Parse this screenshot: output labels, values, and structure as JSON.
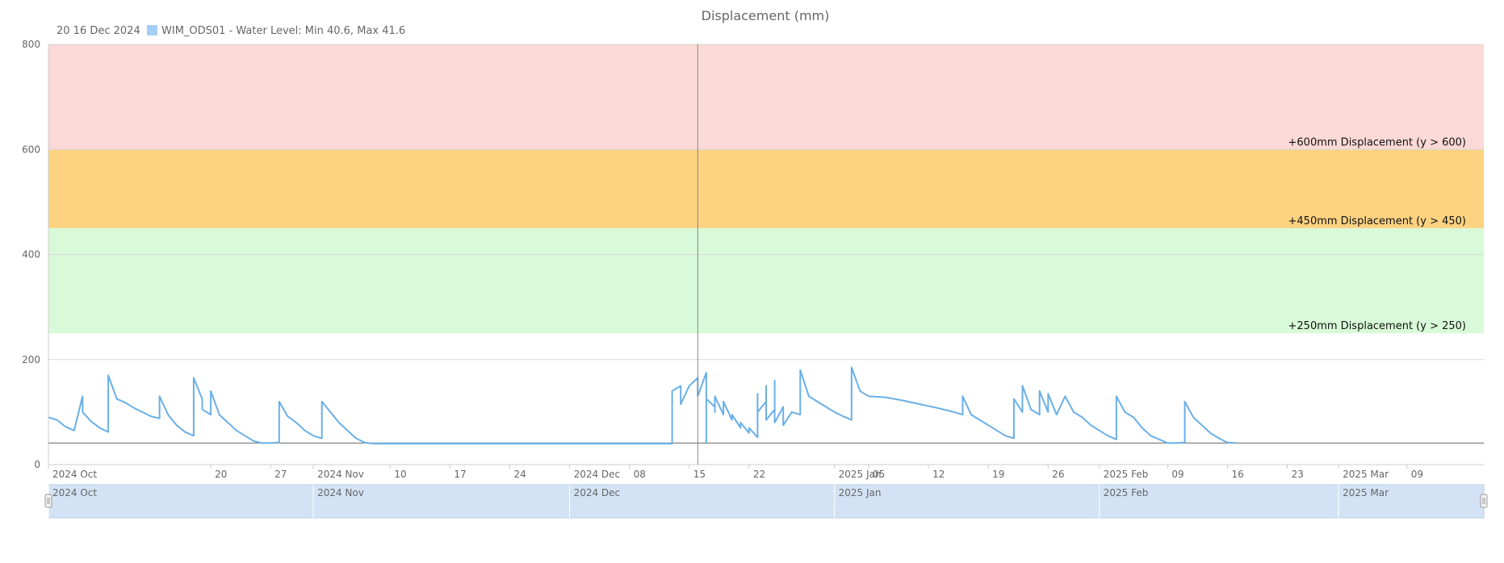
{
  "chart_data": {
    "type": "line",
    "title": "Displacement (mm)",
    "hover_date": "20 16 Dec 2024",
    "legend": {
      "placement": "top-left",
      "items": [
        {
          "label": "WIM_ODS01 - Water Level: Min 40.6, Max 41.6",
          "color": "#a3cef7"
        }
      ]
    },
    "x_range": [
      "2024-10-01",
      "2025-03-18"
    ],
    "ylim": [
      0,
      800
    ],
    "y_ticks": [
      0,
      200,
      400,
      600,
      800
    ],
    "grid": true,
    "x_tick_labels": [
      {
        "date": "2024-10-01",
        "label": "2024 Oct"
      },
      {
        "date": "2024-10-20",
        "label": "20"
      },
      {
        "date": "2024-10-27",
        "label": "27"
      },
      {
        "date": "2024-11-01",
        "label": "2024 Nov"
      },
      {
        "date": "2024-11-10",
        "label": "10"
      },
      {
        "date": "2024-11-17",
        "label": "17"
      },
      {
        "date": "2024-11-24",
        "label": "24"
      },
      {
        "date": "2024-12-01",
        "label": "2024 Dec"
      },
      {
        "date": "2024-12-08",
        "label": "08"
      },
      {
        "date": "2024-12-15",
        "label": "15"
      },
      {
        "date": "2024-12-22",
        "label": "22"
      },
      {
        "date": "2025-01-01",
        "label": "2025 Jan"
      },
      {
        "date": "2025-01-05",
        "label": "05"
      },
      {
        "date": "2025-01-12",
        "label": "12"
      },
      {
        "date": "2025-01-19",
        "label": "19"
      },
      {
        "date": "2025-01-26",
        "label": "26"
      },
      {
        "date": "2025-02-01",
        "label": "2025 Feb"
      },
      {
        "date": "2025-02-09",
        "label": "09"
      },
      {
        "date": "2025-02-16",
        "label": "16"
      },
      {
        "date": "2025-02-23",
        "label": "23"
      },
      {
        "date": "2025-03-01",
        "label": "2025 Mar"
      },
      {
        "date": "2025-03-09",
        "label": "09"
      }
    ],
    "threshold_bands": [
      {
        "from": 600,
        "to": 800,
        "color": "#fbd9d7",
        "label": "+600mm Displacement (y > 600)"
      },
      {
        "from": 450,
        "to": 600,
        "color": "#fdd382",
        "label": "+450mm Displacement (y > 450)"
      },
      {
        "from": 250,
        "to": 450,
        "color": "#d8fad8",
        "label": "+250mm Displacement (y > 250)"
      }
    ],
    "reference_line": {
      "y": 41,
      "color": "#666666"
    },
    "crosshair": {
      "date": "2024-12-16"
    },
    "series": [
      {
        "color": "#6aafe6",
        "points": [
          [
            "2024-10-01",
            90
          ],
          [
            "2024-10-02",
            85
          ],
          [
            "2024-10-03",
            72
          ],
          [
            "2024-10-04",
            65
          ],
          [
            "2024-10-05",
            130
          ],
          [
            "2024-10-05",
            100
          ],
          [
            "2024-10-06",
            82
          ],
          [
            "2024-10-07",
            70
          ],
          [
            "2024-10-08",
            62
          ],
          [
            "2024-10-08",
            170
          ],
          [
            "2024-10-09",
            125
          ],
          [
            "2024-10-10",
            118
          ],
          [
            "2024-10-11",
            108
          ],
          [
            "2024-10-12",
            100
          ],
          [
            "2024-10-13",
            92
          ],
          [
            "2024-10-14",
            88
          ],
          [
            "2024-10-14",
            130
          ],
          [
            "2024-10-15",
            95
          ],
          [
            "2024-10-16",
            75
          ],
          [
            "2024-10-17",
            62
          ],
          [
            "2024-10-18",
            55
          ],
          [
            "2024-10-18",
            165
          ],
          [
            "2024-10-19",
            125
          ],
          [
            "2024-10-19",
            105
          ],
          [
            "2024-10-20",
            95
          ],
          [
            "2024-10-20",
            140
          ],
          [
            "2024-10-21",
            95
          ],
          [
            "2024-10-22",
            80
          ],
          [
            "2024-10-23",
            65
          ],
          [
            "2024-10-24",
            55
          ],
          [
            "2024-10-25",
            45
          ],
          [
            "2024-10-26",
            41
          ],
          [
            "2024-10-27",
            41
          ],
          [
            "2024-10-28",
            42
          ],
          [
            "2024-10-28",
            120
          ],
          [
            "2024-10-29",
            92
          ],
          [
            "2024-10-30",
            80
          ],
          [
            "2024-10-31",
            65
          ],
          [
            "2024-11-01",
            55
          ],
          [
            "2024-11-02",
            50
          ],
          [
            "2024-11-02",
            120
          ],
          [
            "2024-11-03",
            100
          ],
          [
            "2024-11-04",
            80
          ],
          [
            "2024-11-05",
            65
          ],
          [
            "2024-11-06",
            50
          ],
          [
            "2024-11-07",
            42
          ],
          [
            "2024-11-08",
            40
          ],
          [
            "2024-11-15",
            40
          ],
          [
            "2024-11-25",
            40
          ],
          [
            "2024-12-03",
            40
          ],
          [
            "2024-12-12",
            40
          ],
          [
            "2024-12-13",
            40
          ],
          [
            "2024-12-13",
            140
          ],
          [
            "2024-12-14",
            150
          ],
          [
            "2024-12-14",
            115
          ],
          [
            "2024-12-15",
            150
          ],
          [
            "2024-12-16",
            165
          ],
          [
            "2024-12-16",
            130
          ],
          [
            "2024-12-17",
            175
          ],
          [
            "2024-12-18",
            110
          ],
          [
            "2024-12-19",
            95
          ],
          [
            "2024-12-20",
            85
          ],
          [
            "2024-12-21",
            70
          ],
          [
            "2024-12-22",
            60
          ],
          [
            "2024-12-23",
            52
          ],
          [
            "2024-12-23",
            135
          ],
          [
            "2024-12-24",
            120
          ],
          [
            "2024-12-24",
            150
          ],
          [
            "2024-12-25",
            105
          ],
          [
            "2024-12-25",
            160
          ],
          [
            "2024-12-26",
            110
          ],
          [
            "2024-12-27",
            100
          ],
          [
            "2024-12-28",
            95
          ],
          [
            "2024-12-28",
            180
          ],
          [
            "2024-12-29",
            130
          ],
          [
            "2024-12-30",
            120
          ],
          [
            "2024-12-31",
            110
          ],
          [
            "2025-01-01",
            100
          ],
          [
            "2025-01-02",
            92
          ],
          [
            "2025-01-03",
            85
          ],
          [
            "2025-01-03",
            185
          ],
          [
            "2025-01-04",
            140
          ],
          [
            "2025-01-05",
            130
          ],
          [
            "2025-01-07",
            128
          ],
          [
            "2025-01-09",
            122
          ],
          [
            "2025-01-11",
            115
          ],
          [
            "2025-01-13",
            108
          ],
          [
            "2025-01-15",
            100
          ],
          [
            "2025-01-16",
            95
          ],
          [
            "2025-01-16",
            130
          ],
          [
            "2025-01-17",
            95
          ],
          [
            "2025-01-18",
            85
          ],
          [
            "2025-01-19",
            75
          ],
          [
            "2025-01-20",
            65
          ],
          [
            "2025-01-21",
            55
          ],
          [
            "2025-01-22",
            50
          ],
          [
            "2025-01-22",
            125
          ],
          [
            "2025-01-23",
            100
          ],
          [
            "2025-01-23",
            150
          ],
          [
            "2025-01-24",
            105
          ],
          [
            "2025-01-25",
            95
          ],
          [
            "2025-01-25",
            140
          ],
          [
            "2025-01-26",
            100
          ],
          [
            "2025-01-26",
            135
          ],
          [
            "2025-01-27",
            95
          ],
          [
            "2025-01-28",
            130
          ],
          [
            "2025-01-29",
            100
          ],
          [
            "2025-01-30",
            90
          ],
          [
            "2025-01-31",
            75
          ],
          [
            "2025-02-01",
            65
          ],
          [
            "2025-02-02",
            55
          ],
          [
            "2025-02-03",
            48
          ],
          [
            "2025-02-03",
            130
          ],
          [
            "2025-02-04",
            100
          ],
          [
            "2025-02-05",
            90
          ],
          [
            "2025-02-06",
            70
          ],
          [
            "2025-02-07",
            55
          ],
          [
            "2025-02-08",
            48
          ],
          [
            "2025-02-09",
            41
          ],
          [
            "2025-02-10",
            41
          ],
          [
            "2025-02-11",
            42
          ],
          [
            "2025-02-11",
            120
          ],
          [
            "2025-02-12",
            90
          ],
          [
            "2025-02-13",
            75
          ],
          [
            "2025-02-14",
            60
          ],
          [
            "2025-02-15",
            50
          ],
          [
            "2025-02-16",
            42
          ],
          [
            "2025-02-17",
            41
          ],
          [
            "2024-12-17",
            41
          ],
          [
            "2024-12-17",
            125
          ],
          [
            "2024-12-18",
            100
          ],
          [
            "2024-12-18",
            130
          ],
          [
            "2024-12-19",
            100
          ],
          [
            "2024-12-19",
            120
          ],
          [
            "2024-12-20",
            95
          ],
          [
            "2024-12-21",
            80
          ],
          [
            "2024-12-22",
            70
          ],
          [
            "2024-12-23",
            60
          ],
          [
            "2024-12-23",
            100
          ],
          [
            "2024-12-24",
            85
          ],
          [
            "2024-12-25",
            80
          ],
          [
            "2024-12-26",
            75
          ]
        ]
      }
    ]
  },
  "navigator": {
    "labels": [
      {
        "date": "2024-10-01",
        "label": "2024 Oct"
      },
      {
        "date": "2024-11-01",
        "label": "2024 Nov"
      },
      {
        "date": "2024-12-01",
        "label": "2024 Dec"
      },
      {
        "date": "2025-01-01",
        "label": "2025 Jan"
      },
      {
        "date": "2025-02-01",
        "label": "2025 Feb"
      },
      {
        "date": "2025-03-01",
        "label": "2025 Mar"
      }
    ]
  }
}
